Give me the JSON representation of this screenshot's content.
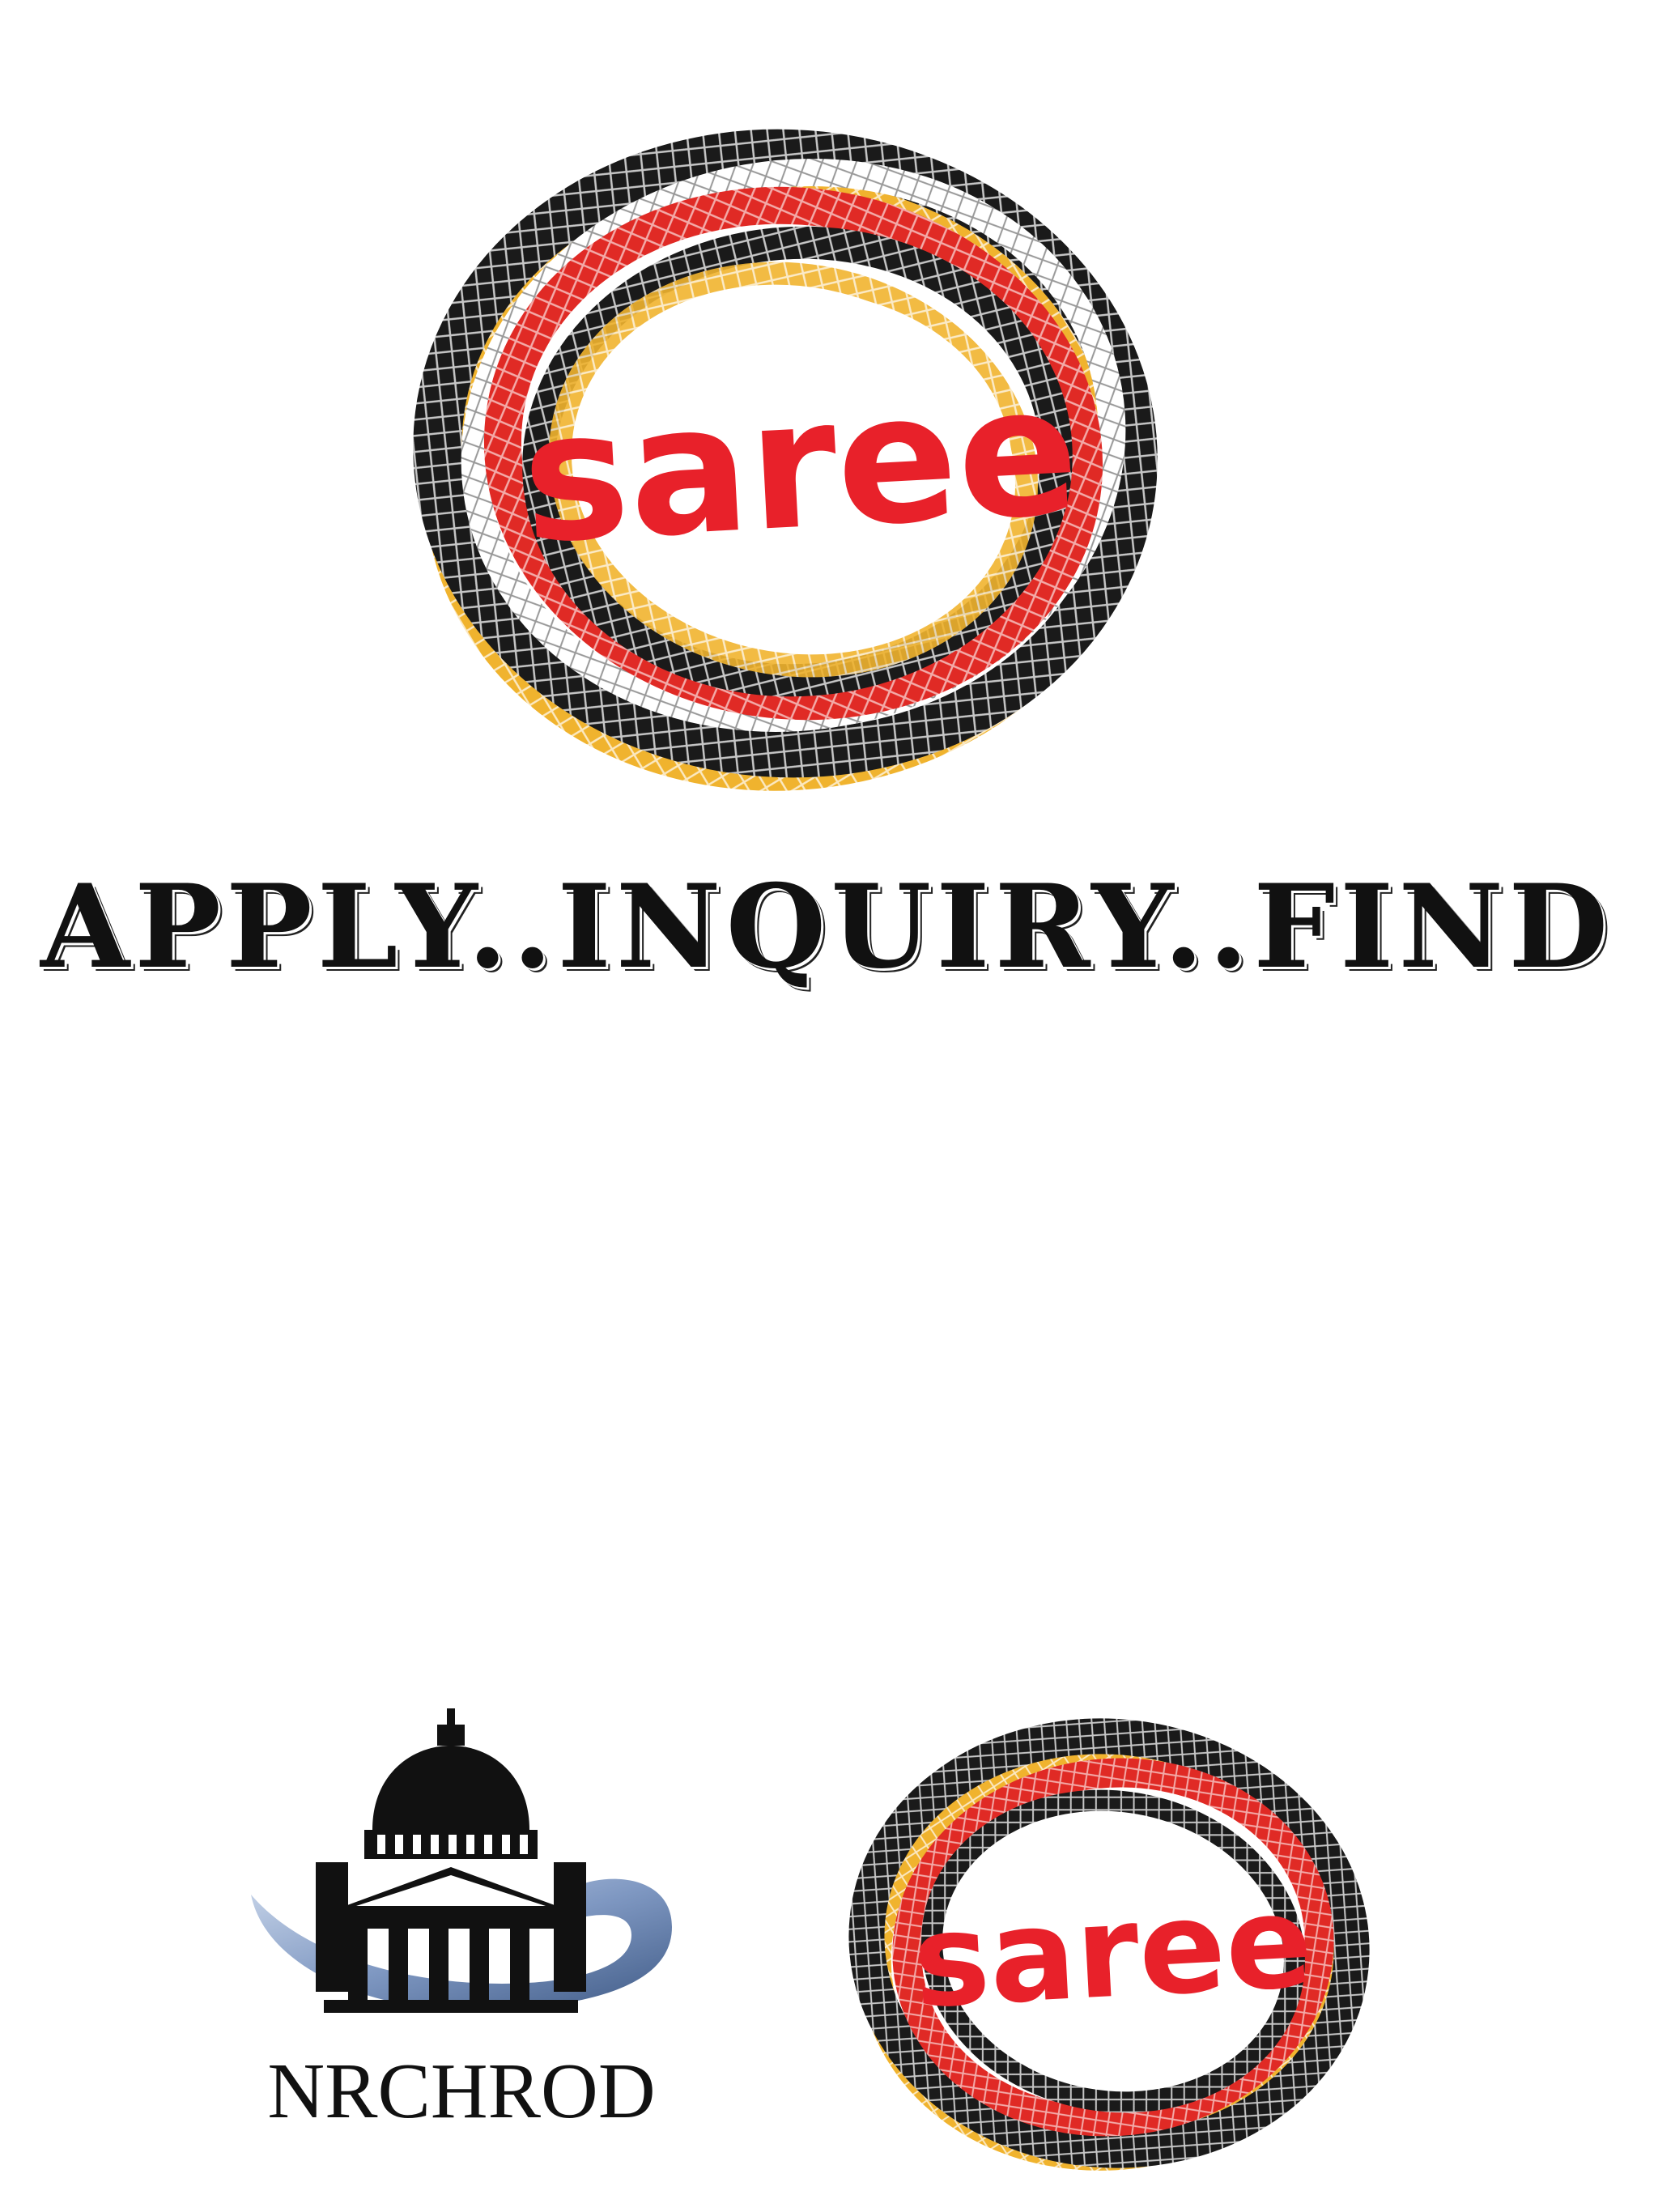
{
  "logos": {
    "saree_text": "saree",
    "nrchrod_text": "NRCHROD"
  },
  "tagline": {
    "text": "APPLY..INQUIRY..FIND"
  },
  "colors": {
    "brand_red": "#e8212a",
    "rope_black": "#1a1a1a",
    "rope_red": "#e02a25",
    "rope_yellow": "#f0b32e",
    "emblem_blue": "#8aa2c8",
    "emblem_black": "#111111"
  },
  "icons": {
    "main_logo": "saree-rope-ring-logo",
    "emblem": "nrchrod-dome-building-emblem",
    "small_logo": "saree-rope-ring-logo"
  }
}
